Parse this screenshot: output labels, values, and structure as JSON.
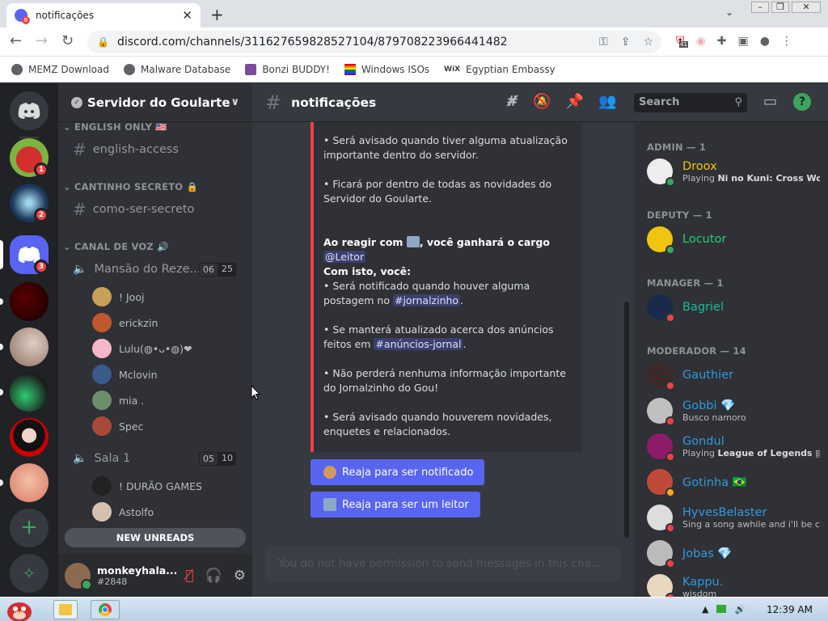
{
  "browser": {
    "tab_title": "notificações",
    "url": "discord.com/channels/311627659828527104/879708223966441482",
    "ext_badge": "41",
    "bookmarks": [
      "MEMZ Download",
      "Malware Database",
      "Bonzi BUDDY!",
      "Windows ISOs",
      "Egyptian Embassy"
    ]
  },
  "server": {
    "name": "Servidor do Goularte",
    "guild_badges": [
      "1",
      "2",
      "3"
    ]
  },
  "channels": {
    "cat_english": "ENGLISH ONLY 🇺🇸",
    "english_access": "english-access",
    "cat_secret": "CANTINHO SECRETO 🔒",
    "secret": "como-ser-secreto",
    "cat_voice": "CANAL DE VOZ 🔊",
    "voice1": {
      "name": "Mansão do Reze...",
      "count": "06",
      "limit": "25",
      "users": [
        "! Jooj",
        "erickzin",
        "Lulu(◍•ᴗ•◍)❤",
        "Mclovin",
        "mia .",
        "Spec"
      ]
    },
    "voice2": {
      "name": "Sala 1",
      "count": "05",
      "limit": "10",
      "users": [
        "! DURÃO GAMES",
        "Astolfo"
      ]
    },
    "new_unreads": "NEW UNREADS"
  },
  "user": {
    "name": "monkeyhala...",
    "tag": "#2848"
  },
  "main": {
    "channel": "notificações",
    "search": "Search",
    "embed": {
      "l1": "• Será avisado quando tiver alguma atualização importante dentro do servidor.",
      "l2": "• Ficará por dentro de todas as novidades do Servidor do Goularte.",
      "react_a": "Ao reagir com ",
      "react_b": ", você ganhará o cargo ",
      "role": "@Leitor",
      "com_isto": "Com isto, você:",
      "n1a": "• Será notificado quando houver alguma postagem no ",
      "ch1": "#jornalzinho",
      "n2a": "• Se manterá atualizado acerca dos anúncios feitos em ",
      "ch2": "#anúncios-jornal",
      "n3": "• Não perderá nenhuma informação importante do Jornalzinho do Gou!",
      "n4": "• Será avisado quando houverem novidades, enquetes e relacionados."
    },
    "btn1": "Reaja para ser notificado",
    "btn2": "Reaja para ser um leitor",
    "input_placeholder": "You do not have permission to send messages in this cha..."
  },
  "members": {
    "cat_admin": "ADMIN — 1",
    "cat_deputy": "DEPUTY — 1",
    "cat_manager": "MANAGER — 1",
    "cat_mod": "MODERADOR — 14",
    "list": [
      {
        "name": "Droox",
        "color": "#f1c40f",
        "act_a": "Playing ",
        "act_b": "Ni no Kuni: Cross Worl..."
      },
      {
        "name": "Locutor",
        "color": "#2ecc71",
        "act_a": "",
        "act_b": ""
      },
      {
        "name": "Bagriel",
        "color": "#1abc9c",
        "act_a": "",
        "act_b": ""
      },
      {
        "name": "Gauthier",
        "color": "#3498db",
        "act_a": "",
        "act_b": ""
      },
      {
        "name": "Gobbi 💎",
        "color": "#3498db",
        "act_a": "Busco namoro",
        "act_b": ""
      },
      {
        "name": "Gondul",
        "color": "#3498db",
        "act_a": "Playing ",
        "act_b": "League of Legends"
      },
      {
        "name": "Gotinha 🇧🇷",
        "color": "#3498db",
        "act_a": "",
        "act_b": ""
      },
      {
        "name": "HyvesBelaster",
        "color": "#3498db",
        "act_a": "Sing a song awhile and i'll be c...",
        "act_b": ""
      },
      {
        "name": "Jobas 💎",
        "color": "#3498db",
        "act_a": "",
        "act_b": ""
      },
      {
        "name": "Kappu.",
        "color": "#3498db",
        "act_a": "wisdom",
        "act_b": ""
      }
    ]
  },
  "taskbar": {
    "clock": "12:39 AM"
  }
}
